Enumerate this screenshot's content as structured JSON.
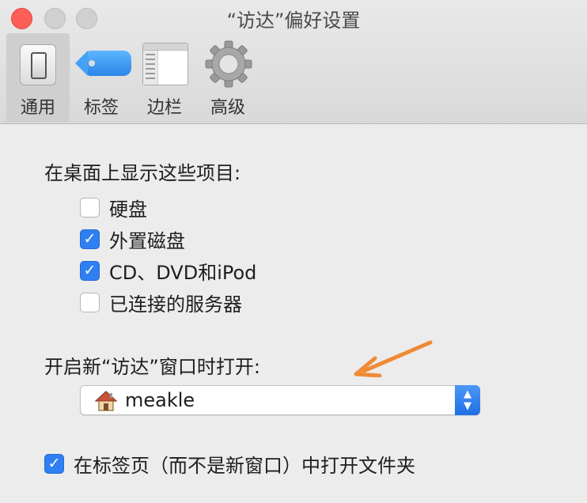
{
  "window": {
    "title": "“访达”偏好设置"
  },
  "toolbar": {
    "items": [
      {
        "label": "通用",
        "icon": "general-switch-icon",
        "selected": true
      },
      {
        "label": "标签",
        "icon": "tag-icon",
        "selected": false
      },
      {
        "label": "边栏",
        "icon": "sidebar-icon",
        "selected": false
      },
      {
        "label": "高级",
        "icon": "gear-icon",
        "selected": false
      }
    ]
  },
  "desktop_items": {
    "heading": "在桌面上显示这些项目:",
    "options": [
      {
        "label": "硬盘",
        "checked": false
      },
      {
        "label": "外置磁盘",
        "checked": true
      },
      {
        "label": "CD、DVD和iPod",
        "checked": true
      },
      {
        "label": "已连接的服务器",
        "checked": false
      }
    ]
  },
  "new_window": {
    "heading": "开启新“访达”窗口时打开:",
    "selected_value": "meakle",
    "selected_icon": "home-icon"
  },
  "tabs_option": {
    "label": "在标签页（而不是新窗口）中打开文件夹",
    "checked": true
  },
  "check_glyph": "✓",
  "colors": {
    "accent": "#2f7ff2",
    "annotation_arrow": "#f08a36",
    "close_button": "#fd5f57"
  }
}
